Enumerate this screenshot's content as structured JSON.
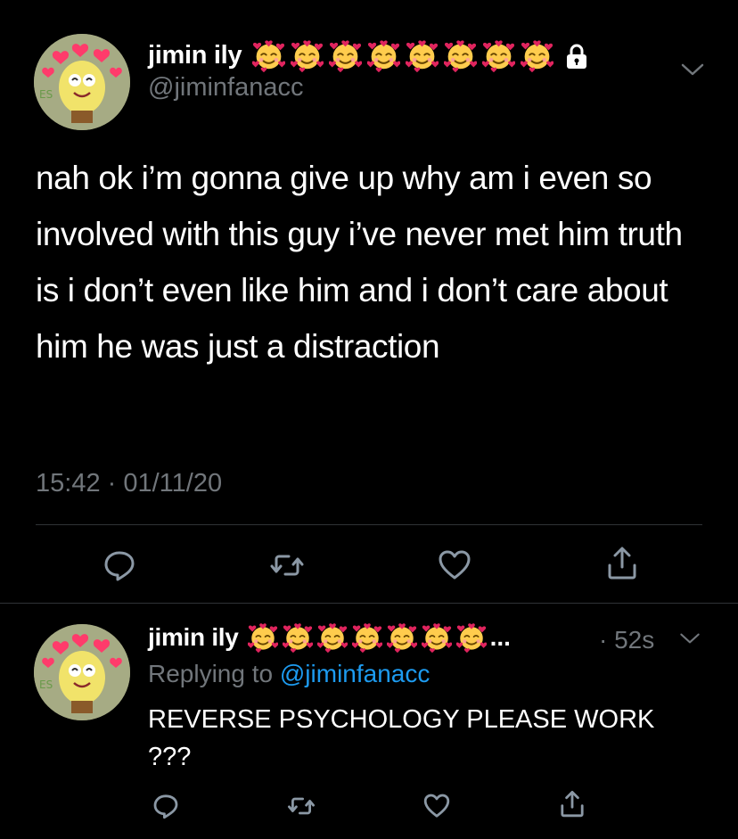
{
  "tweet": {
    "display_name": "jimin ily",
    "handle": "@jiminfanacc",
    "emoji_count": 8,
    "emoji_name": "smiling-face-with-hearts",
    "protected_icon": "lock-icon",
    "menu_icon": "chevron-down-icon",
    "text": "nah ok i’m gonna give up why am i even so involved with this guy i’ve never met him truth is i don’t even like him and i don’t care about him he was just a distraction",
    "timestamp": "15:42 · 01/11/20",
    "actions": [
      "reply-icon",
      "retweet-icon",
      "like-icon",
      "share-icon"
    ]
  },
  "reply": {
    "display_name": "jimin ily",
    "emoji_count": 7,
    "ellipsis": "...",
    "time": "· 52s",
    "replying_to_prefix": "Replying to",
    "replying_to_handle": "@jiminfanacc",
    "text": "REVERSE PSYCHOLOGY PLEASE WORK ???",
    "actions": [
      "reply-icon",
      "retweet-icon",
      "like-icon",
      "share-icon"
    ]
  },
  "colors": {
    "background": "#000000",
    "primary_text": "#ffffff",
    "secondary_text": "#71767b",
    "link": "#1d9bf0",
    "divider": "#2f3336",
    "emoji_face": "#ffcc4d",
    "emoji_heart": "#e0245e"
  }
}
